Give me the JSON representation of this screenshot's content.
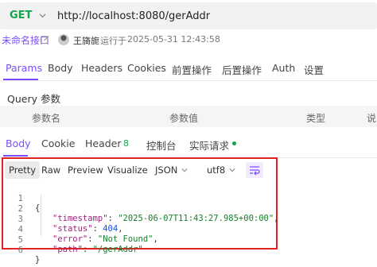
{
  "request": {
    "method": "GET",
    "url": "http://localhost:8080/gerAddr"
  },
  "meta": {
    "api_name": "未命名接口",
    "author": "王旖旎",
    "run_label": "运行于",
    "run_time": "2025-05-31 12:43:58"
  },
  "request_tabs": [
    "Params",
    "Body",
    "Headers",
    "Cookies",
    "前置操作",
    "后置操作",
    "Auth",
    "设置"
  ],
  "query": {
    "title": "Query 参数",
    "columns": [
      "参数名",
      "参数值",
      "类型",
      "说"
    ]
  },
  "response_tabs": {
    "body": "Body",
    "cookie": "Cookie",
    "header": "Header",
    "header_count": "8",
    "console": "控制台",
    "actual_request": "实际请求"
  },
  "response_toolbar": {
    "pretty": "Pretty",
    "raw": "Raw",
    "preview": "Preview",
    "visualize": "Visualize",
    "format": "JSON",
    "encoding": "utf8"
  },
  "response_body": {
    "line_numbers": [
      "1",
      "2",
      "3",
      "4",
      "5",
      "6"
    ],
    "open_brace": "{",
    "close_brace": "}",
    "timestamp_key": "\"timestamp\"",
    "timestamp_value": "\"2025-06-07T11:43:27.985+00:00\"",
    "status_key": "\"status\"",
    "status_value": "404",
    "error_key": "\"error\"",
    "error_value": "\"Not Found\"",
    "path_key": "\"path\"",
    "path_value": "\"/gerAddr\""
  },
  "colors": {
    "accent": "#7c4dff",
    "method_green": "#15a34a",
    "highlight_red": "#e0241f"
  }
}
